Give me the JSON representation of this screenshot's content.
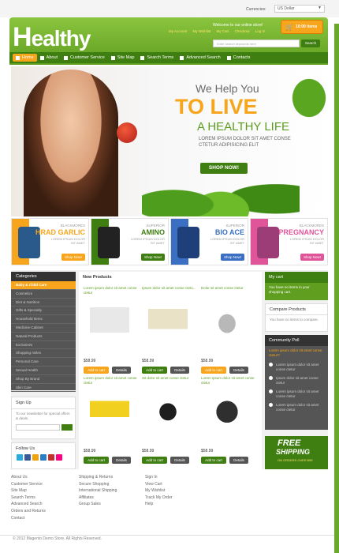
{
  "topbar": {
    "currency_label": "Currencies:",
    "currency_value": "US Dollar"
  },
  "header": {
    "logo": "ealthy",
    "logo_initial": "H",
    "welcome": "Welcome to our online store!",
    "links": [
      "My Account",
      "My Wishlist",
      "My Cart",
      "Checkout",
      "Log In"
    ],
    "cart_label": "10:00 items",
    "search_placeholder": "Enter search keywords here",
    "search_button": "Search"
  },
  "nav": [
    "Home",
    "About",
    "Customer Service",
    "Site Map",
    "Search Terms",
    "Advanced Search",
    "Contacts"
  ],
  "banner": {
    "line1": "We Help You",
    "line2": "TO LIVE",
    "line3": "A HEALTHY LIFE",
    "line4": "LOREM IPSUM DOLOR SIT AMET CONSE CTETUR ADIPISICING ELIT",
    "button": "SHOP NOW!"
  },
  "promos": [
    {
      "brand": "BLACKMORES",
      "name": "HRAD GARLIC",
      "text": "LOREM IPSUM DOLOR SIT AMET",
      "button": "Shop Now!",
      "color": "#f7a51c"
    },
    {
      "brand": "SUPERIOR",
      "name": "AMINO",
      "text": "LOREM IPSUM DOLOR SIT AMET",
      "button": "Shop Now!",
      "color": "#3f7e11"
    },
    {
      "brand": "SUPERIOR",
      "name": "BIO ACE",
      "text": "LOREM IPSUM DOLOR SIT AMET",
      "button": "Shop Now!",
      "color": "#3a6fc4"
    },
    {
      "brand": "BLACKMORES",
      "name": "PREGNANCY",
      "text": "LOREM IPSUM DOLOR SIT AMET",
      "button": "Shop Now!",
      "color": "#e0559a"
    }
  ],
  "categories": {
    "title": "Categories",
    "items": [
      "Baby & Child Care",
      "Cosmetics",
      "Diet & Nutrition",
      "Gifts & Specialty",
      "Household Items",
      "Medicine Cabinet",
      "Natural Products",
      "Exclusives",
      "Shopping Aisles",
      "Personal Care",
      "Sexual Health",
      "Shop By Brand",
      "Skin Care"
    ]
  },
  "signup": {
    "title": "Sign Up",
    "text": "To our newsletter for special offers & deals."
  },
  "follow": {
    "title": "Follow Us"
  },
  "products": {
    "title": "New Products",
    "items": [
      {
        "name": "Lorem ipsum dolor sit amet conse ctetur",
        "price": "$58.99",
        "add": "Add to cart",
        "details": "Details",
        "color": "#f7a51c"
      },
      {
        "name": "Ipsum dolor sit amet conse ctetu...",
        "price": "$58.99",
        "add": "Add to cart",
        "details": "Details",
        "color": "#3f7e11"
      },
      {
        "name": "Dolor sit amet conse ctetur",
        "price": "$58.99",
        "add": "Add to cart",
        "details": "Details",
        "color": "#f7a51c"
      },
      {
        "name": "Lorem ipsum dolor sit amet conse ctetur",
        "price": "$58.99",
        "add": "Add to cart",
        "details": "Details",
        "color": "#3f7e11"
      },
      {
        "name": "Sit dolor sit amet conse ctetur",
        "price": "$58.99",
        "add": "Add to cart",
        "details": "Details",
        "color": "#3f7e11"
      },
      {
        "name": "Lorem ipsum dolor sit amet conse ctetur",
        "price": "$58.99",
        "add": "Add to cart",
        "details": "Details",
        "color": "#3f7e11"
      }
    ]
  },
  "mycart": {
    "title": "My cart",
    "text": "You have no items in your shopping cart."
  },
  "compare": {
    "title": "Compare Products",
    "text": "You have no items to compare."
  },
  "poll": {
    "title": "Community Poll",
    "question": "Lorem ipsum dolor sit amet conse ctetur?",
    "options": [
      "Lorem ipsum dolor sit amet conse ctetur",
      "Ipsum dolor sit amet conse ctetur",
      "Lorem ipsum dolor sit amet conse ctetur",
      "Lorem ipsum dolor sit amet conse ctetur"
    ]
  },
  "freeship": {
    "line1": "FREE",
    "line2": "SHIPPING",
    "line3": "ON ORDERS OVER $99"
  },
  "footer": {
    "col1": [
      "About Us",
      "Customer Service",
      "Site Map",
      "Search Terms",
      "Advanced Search",
      "Orders and Returns",
      "Contact"
    ],
    "col2": [
      "Shipping & Returns",
      "Secure Shopping",
      "International Shipping",
      "Affiliates",
      "Group Sales"
    ],
    "col3": [
      "Sign In",
      "View Cart",
      "My Wishlist",
      "Track My Order",
      "Help"
    ],
    "copyright": "© 2012 Magento Demo Store. All Rights Reserved."
  }
}
